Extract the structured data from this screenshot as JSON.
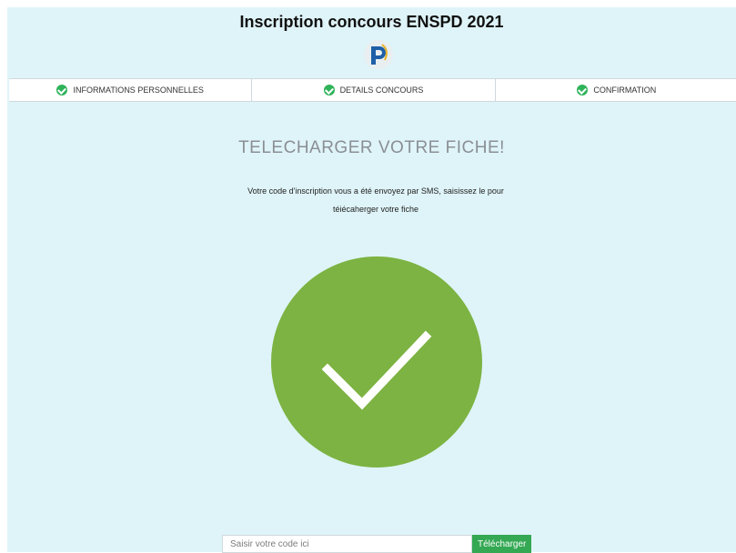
{
  "header": {
    "title": "Inscription concours ENSPD 2021",
    "logo_icon": "enspd-logo-icon"
  },
  "steps": [
    {
      "label": "INFORMATIONS PERSONNELLES",
      "icon": "check-circle-icon",
      "status": "completed"
    },
    {
      "label": "DETAILS CONCOURS",
      "icon": "check-circle-icon",
      "status": "completed"
    },
    {
      "label": "CONFIRMATION",
      "icon": "check-circle-icon",
      "status": "completed"
    }
  ],
  "main": {
    "heading": "TELECHARGER VOTRE FICHE!",
    "message_line1": "Votre code d'inscription vous a été envoyez par SMS, saisissez le pour",
    "message_line2": "téiécaherger votre fiche",
    "success_icon": "large-check-icon"
  },
  "download": {
    "placeholder": "Saisir votre code ici",
    "button_label": "Télécharger"
  },
  "colors": {
    "background": "#dff4f8",
    "success_green": "#7cb342",
    "step_check_green": "#2fb35a",
    "button_green": "#34a853"
  }
}
